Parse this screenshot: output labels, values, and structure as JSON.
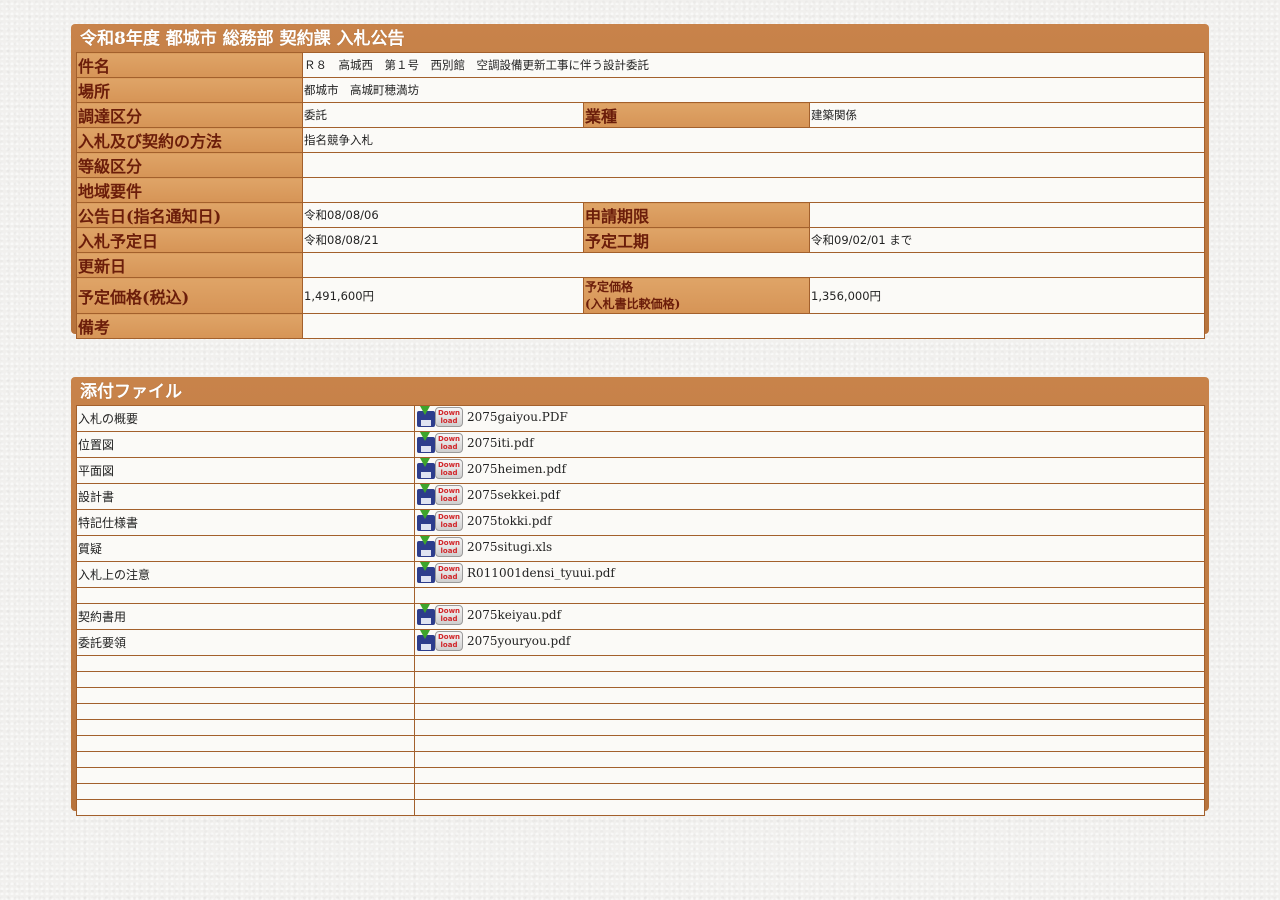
{
  "notice": {
    "title": "令和8年度 都城市 総務部 契約課 入札公告",
    "rows": {
      "subject": {
        "label": "件名",
        "value": "Ｒ８　高城西　第１号　西別館　空調設備更新工事に伴う設計委託"
      },
      "location": {
        "label": "場所",
        "value": "都城市　高城町穂満坊"
      },
      "procurement": {
        "label": "調達区分",
        "value": "委託",
        "label2": "業種",
        "value2": "建築関係"
      },
      "method": {
        "label": "入札及び契約の方法",
        "value": "指名競争入札"
      },
      "grade": {
        "label": "等級区分",
        "value": ""
      },
      "region": {
        "label": "地域要件",
        "value": ""
      },
      "announce": {
        "label": "公告日(指名通知日)",
        "value": "令和08/08/06",
        "label2": "申請期限",
        "value2": ""
      },
      "bid": {
        "label": "入札予定日",
        "value": "令和08/08/21",
        "label2": "予定工期",
        "value2": "令和09/02/01 まで"
      },
      "updated": {
        "label": "更新日",
        "value": ""
      },
      "price": {
        "label": "予定価格(税込)",
        "value": "1,491,600円",
        "label2a": "予定価格",
        "label2b": "(入札書比較価格)",
        "value2": "1,356,000円"
      },
      "remarks": {
        "label": "備考",
        "value": ""
      }
    }
  },
  "attachments": {
    "title": "添付ファイル",
    "icon_text_top": "Down",
    "icon_text_bottom": "load",
    "files": [
      {
        "name": "入札の概要",
        "file": "2075gaiyou.PDF"
      },
      {
        "name": "位置図",
        "file": "2075iti.pdf"
      },
      {
        "name": "平面図",
        "file": "2075heimen.pdf"
      },
      {
        "name": "設計書",
        "file": "2075sekkei.pdf"
      },
      {
        "name": "特記仕様書",
        "file": "2075tokki.pdf"
      },
      {
        "name": "質疑",
        "file": "2075situgi.xls"
      },
      {
        "name": "入札上の注意",
        "file": "R011001densi_tyuui.pdf"
      },
      {
        "name": "契約書用",
        "file": "2075keiyau.pdf"
      },
      {
        "name": "委託要領",
        "file": "2075youryou.pdf"
      }
    ]
  }
}
